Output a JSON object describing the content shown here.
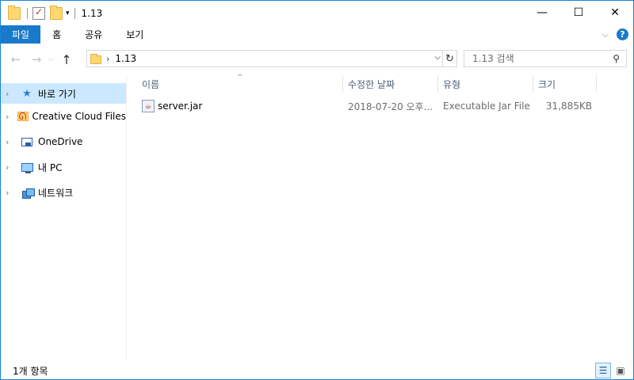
{
  "window": {
    "title": "1.13"
  },
  "ribbon": {
    "tabs": [
      "파일",
      "홈",
      "공유",
      "보기"
    ]
  },
  "address": {
    "crumb": "1.13"
  },
  "search": {
    "placeholder": "1.13 검색"
  },
  "nav": {
    "items": [
      {
        "label": "바로 가기",
        "icon": "quick-access-star-icon",
        "selected": true
      },
      {
        "label": "Creative Cloud Files",
        "icon": "creative-cloud-folder-icon"
      },
      {
        "label": "OneDrive",
        "icon": "onedrive-icon"
      },
      {
        "label": "내 PC",
        "icon": "this-pc-icon"
      },
      {
        "label": "네트워크",
        "icon": "network-icon"
      }
    ]
  },
  "columns": {
    "name": "이름",
    "date": "수정한 날짜",
    "type": "유형",
    "size": "크기"
  },
  "files": [
    {
      "name": "server.jar",
      "date": "2018-07-20 오후...",
      "type": "Executable Jar File",
      "size": "31,885KB",
      "icon": "jar-file-icon"
    }
  ],
  "status": {
    "count": "1개 항목"
  },
  "colors": {
    "accent": "#1979ca",
    "selection": "#cce8ff",
    "header_text": "#4c607a"
  }
}
